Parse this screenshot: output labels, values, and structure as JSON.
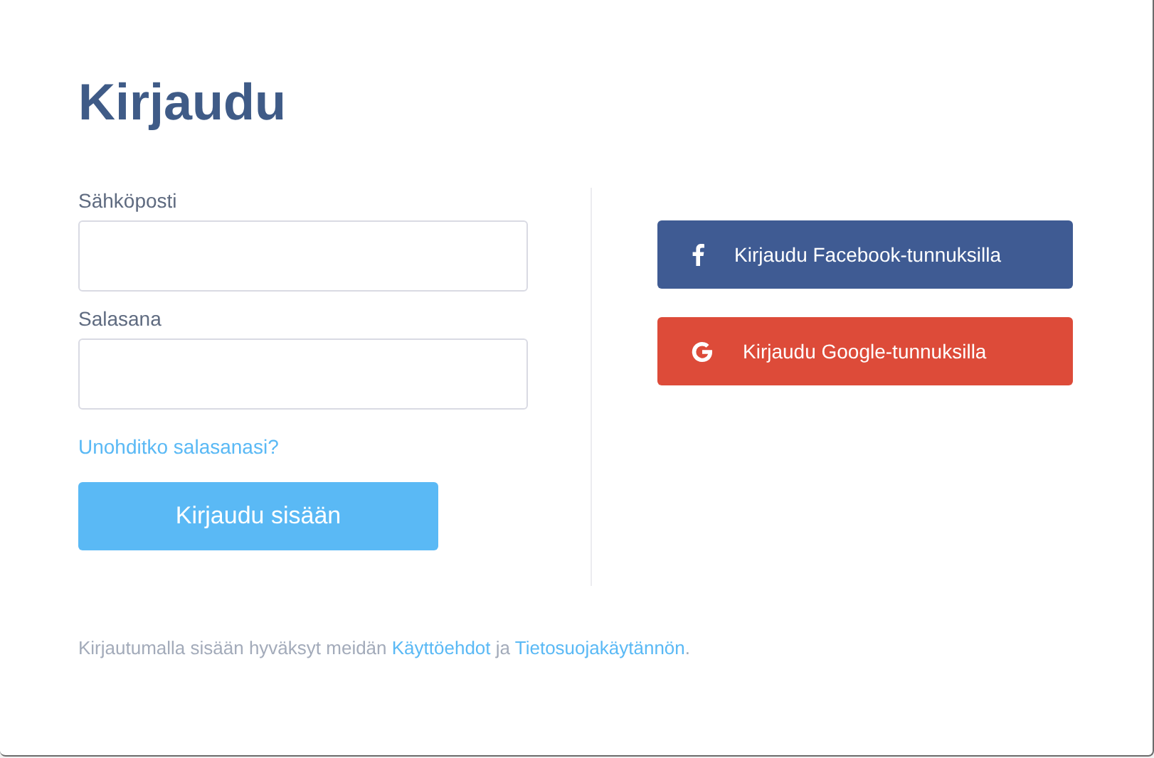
{
  "title": "Kirjaudu",
  "fields": [
    {
      "label": "Sähköposti"
    },
    {
      "label": "Salasana"
    }
  ],
  "forgot_link": "Unohditko salasanasi?",
  "submit_button": "Kirjaudu sisään",
  "social_buttons": [
    {
      "kind": "facebook",
      "label": "Kirjaudu Facebook-tunnuksilla"
    },
    {
      "kind": "google",
      "label": "Kirjaudu Google-tunnuksilla"
    }
  ],
  "footer": [
    {
      "kind": "text",
      "text": "Kirjautumalla sisään hyväksyt meidän "
    },
    {
      "kind": "link",
      "text": "Käyttöehdot"
    },
    {
      "kind": "text",
      "text": " ja "
    },
    {
      "kind": "link",
      "text": "Tietosuojakäytännön"
    },
    {
      "kind": "text",
      "text": "."
    }
  ]
}
